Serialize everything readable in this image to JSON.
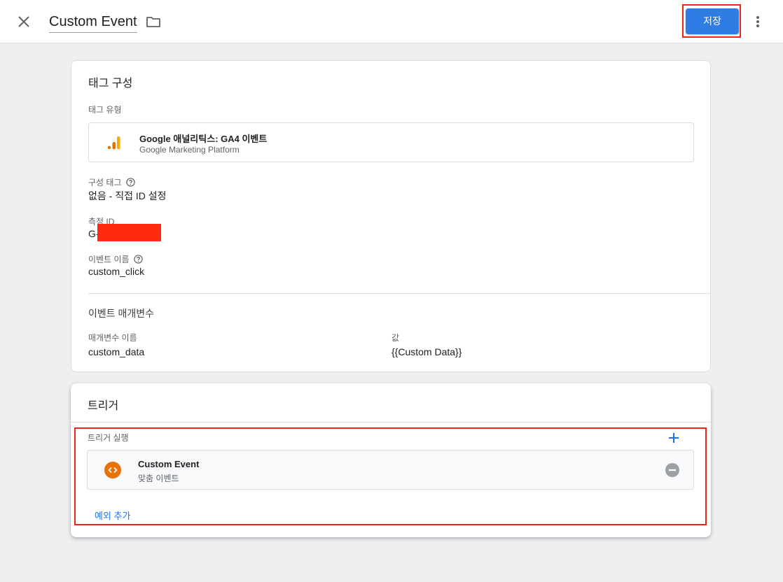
{
  "header": {
    "title": "Custom Event",
    "save_label": "저장"
  },
  "tag_config": {
    "section_title": "태그 구성",
    "tag_type_label": "태그 유형",
    "tag_type_name": "Google 애널리틱스: GA4 이벤트",
    "tag_type_sub": "Google Marketing Platform",
    "config_tag_label": "구성 태그",
    "config_tag_value": "없음 - 직접 ID 설정",
    "measurement_id_label": "측정 ID",
    "measurement_id_prefix": "G-",
    "event_name_label": "이벤트 이름",
    "event_name_value": "custom_click",
    "event_params_title": "이벤트 매개변수",
    "param_name_header": "매개변수 이름",
    "param_value_header": "값",
    "params": [
      {
        "name": "custom_data",
        "value": "{{Custom Data}}"
      }
    ]
  },
  "triggers": {
    "section_title": "트리거",
    "firing_label": "트리거 실행",
    "items": [
      {
        "name": "Custom Event",
        "type": "맞춤 이벤트"
      }
    ],
    "add_exception_label": "예외 추가"
  },
  "colors": {
    "primary": "#2f7ce4",
    "highlight": "#e8271a",
    "ga_orange": "#f9ab00",
    "ga_dark_orange": "#e37400",
    "trigger_icon": "#e8710a",
    "link": "#1a73e8"
  },
  "icons": {
    "close": "close-icon",
    "folder": "folder-icon",
    "more": "more-vert-icon",
    "help": "help-icon",
    "analytics": "analytics-icon",
    "code": "code-icon",
    "add": "plus-icon",
    "remove": "remove-circle-icon"
  }
}
